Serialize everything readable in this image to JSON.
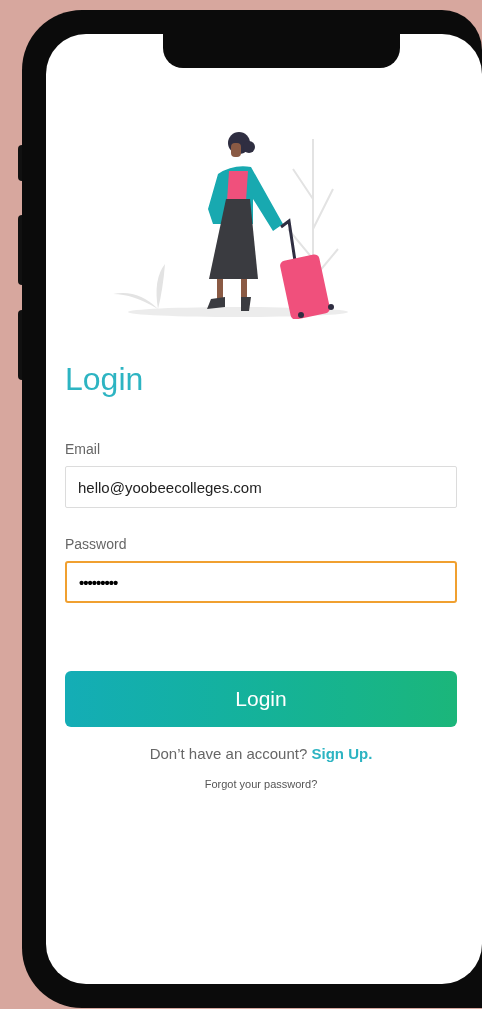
{
  "screen": {
    "title": "Login",
    "fields": [
      {
        "label": "Email",
        "kind": "text",
        "value": "hello@yoobeecolleges.com",
        "focused": false
      },
      {
        "label": "Password",
        "kind": "password",
        "value": "•••••••••",
        "focused": true
      }
    ],
    "button": "Login",
    "signup": {
      "prompt": "Don’t have an account?",
      "link": "Sign Up."
    },
    "forgot": "Forgot your password?"
  }
}
